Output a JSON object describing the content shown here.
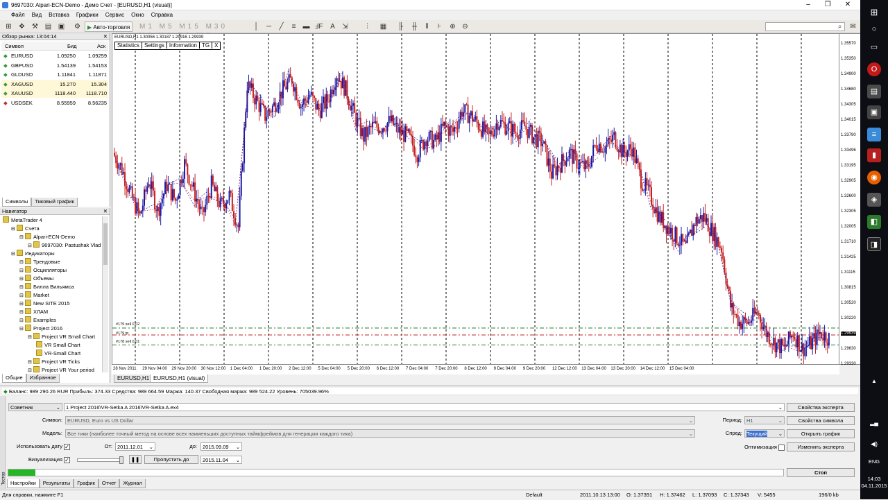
{
  "window": {
    "title": "9697030: Alpari-ECN-Demo - Демо Счет - [EURUSD,H1 (visual)]"
  },
  "menu": [
    "Файл",
    "Вид",
    "Вставка",
    "Графики",
    "Сервис",
    "Окно",
    "Справка"
  ],
  "toolbar": {
    "autotrade": "Авто-торговля",
    "timeframes": [
      "M1",
      "M5",
      "M15",
      "M30",
      "H1",
      "H4",
      "D1",
      "W1",
      "MN"
    ]
  },
  "market_watch": {
    "header": "Обзор рынка: 13:04:14",
    "columns": [
      "Символ",
      "Бид",
      "Аск"
    ],
    "rows": [
      {
        "symbol": "EURUSD",
        "bid": "1.09250",
        "ask": "1.09259",
        "color": "#3a9a3a"
      },
      {
        "symbol": "GBPUSD",
        "bid": "1.54139",
        "ask": "1.54153",
        "color": "#3a9a3a"
      },
      {
        "symbol": "GLDUSD",
        "bid": "1.11841",
        "ask": "1.11871",
        "color": "#3a9a3a"
      },
      {
        "symbol": "XAGUSD",
        "bid": "15.270",
        "ask": "15.304",
        "color": "#3a9a3a"
      },
      {
        "symbol": "XAUUSD",
        "bid": "1118.440",
        "ask": "1118.710",
        "color": "#3a9a3a"
      },
      {
        "symbol": "USDSEK",
        "bid": "8.55959",
        "ask": "8.56235",
        "color": "#c03030"
      }
    ],
    "tabs": [
      "Символы",
      "Тиковый график"
    ]
  },
  "navigator": {
    "header": "Навигатор",
    "items": [
      {
        "label": "MetaTrader 4",
        "level": 0
      },
      {
        "label": "Счета",
        "level": 1
      },
      {
        "label": "Alpari-ECN-Demo",
        "level": 2
      },
      {
        "label": "9697030: Pastushak Vlad",
        "level": 3
      },
      {
        "label": "Индикаторы",
        "level": 1
      },
      {
        "label": "Трендовые",
        "level": 2
      },
      {
        "label": "Осцилляторы",
        "level": 2
      },
      {
        "label": "Объемы",
        "level": 2
      },
      {
        "label": "Билла Вильямса",
        "level": 2
      },
      {
        "label": "Market",
        "level": 2
      },
      {
        "label": "New SITE 2015",
        "level": 2
      },
      {
        "label": "ХЛАМ",
        "level": 2
      },
      {
        "label": "Examples",
        "level": 2
      },
      {
        "label": "Project 2016",
        "level": 2
      },
      {
        "label": "Project VR Small Chart",
        "level": 3
      },
      {
        "label": "VR Small Chart",
        "level": 4
      },
      {
        "label": "VR-Small Chart",
        "level": 4
      },
      {
        "label": "Project VR Ticks",
        "level": 3
      },
      {
        "label": "Project VR Your period",
        "level": 3
      }
    ],
    "tabs": [
      "Общие",
      "Избранное"
    ]
  },
  "chart": {
    "info": "EURUSD,H1  1.30056 1.30187 1.29916 1.29939",
    "overlay_tabs": [
      "Statistics",
      "Settings",
      "Information",
      "TG",
      "X"
    ],
    "order_labels": [
      "#179 sell 0.02",
      "#179 tp",
      "#178 sell 0.01"
    ],
    "tabs": [
      "EURUSD,H1",
      "EURUSD,H1 (visual)"
    ],
    "current_price": "1.29939",
    "colors": {
      "bull": "#1a1aa8",
      "bear": "#c81e1e",
      "grid": "#000000"
    }
  },
  "chart_data": {
    "type": "candlestick",
    "symbol": "EURUSD",
    "timeframe": "H1",
    "x_ticks": [
      "28 Nov 2011",
      "29 Nov 04:00",
      "29 Nov 20:00",
      "30 Nov 12:00",
      "1 Dec 04:00",
      "1 Dec 20:00",
      "2 Dec 12:00",
      "5 Dec 04:00",
      "5 Dec 20:00",
      "6 Dec 12:00",
      "7 Dec 04:00",
      "7 Dec 20:00",
      "8 Dec 12:00",
      "9 Dec 04:00",
      "9 Dec 20:00",
      "12 Dec 12:00",
      "13 Dec 04:00",
      "13 Dec 20:00",
      "14 Dec 12:00",
      "15 Dec 04:00"
    ],
    "y_ticks": [
      "1.35570",
      "1.35350",
      "1.34900",
      "1.34680",
      "1.34305",
      "1.34015",
      "1.33790",
      "1.33496",
      "1.33195",
      "1.32905",
      "1.32600",
      "1.32305",
      "1.32005",
      "1.31710",
      "1.31425",
      "1.31115",
      "1.30815",
      "1.30520",
      "1.30220",
      "1.29939",
      "1.29630",
      "1.29330"
    ],
    "ylim": [
      1.2933,
      1.3557
    ],
    "close_path": [
      1.334,
      1.331,
      1.326,
      1.322,
      1.329,
      1.323,
      1.328,
      1.325,
      1.332,
      1.327,
      1.322,
      1.328,
      1.324,
      1.326,
      1.32,
      1.347,
      1.344,
      1.341,
      1.343,
      1.346,
      1.348,
      1.343,
      1.345,
      1.342,
      1.344,
      1.349,
      1.346,
      1.341,
      1.337,
      1.339,
      1.339,
      1.34,
      1.338,
      1.337,
      1.334,
      1.337,
      1.336,
      1.339,
      1.338,
      1.342,
      1.341,
      1.339,
      1.337,
      1.34,
      1.339,
      1.338,
      1.339,
      1.337,
      1.336,
      1.33,
      1.332,
      1.334,
      1.332,
      1.331,
      1.336,
      1.335,
      1.337,
      1.334,
      1.335,
      1.329,
      1.326,
      1.322,
      1.32,
      1.318,
      1.316,
      1.321,
      1.322,
      1.319,
      1.316,
      1.305,
      1.302,
      1.302,
      1.304,
      1.3,
      1.298,
      1.297,
      1.3,
      1.297,
      1.298,
      1.3,
      1.299
    ],
    "order_levels": [
      {
        "label": "#179 sell 0.02",
        "value": 1.3009
      },
      {
        "label": "#179 tp",
        "value": 1.2996
      },
      {
        "label": "#178 sell 0.01",
        "value": 1.2977
      }
    ]
  },
  "tester": {
    "type_value": "Советник",
    "expert_value": "1 Project 2016\\VR-Setka A 2016\\VR-Setka A.ex4",
    "symbol_label": "Символ:",
    "symbol_value": "EURUSD, Euro vs US Dollar",
    "model_label": "Модель:",
    "model_value": "Все тики (наиболее точный метод на основе всех наименьших доступных таймфреймов для генерации каждого тика)",
    "use_date_label": "Использовать дату",
    "from_label": "От:",
    "from_value": "2011.12.01",
    "to_label": "до:",
    "to_value": "2015.09.09",
    "visual_label": "Визуализация",
    "skip_label": "Пропустить до",
    "skip_value": "2015.11.04",
    "period_label": "Период:",
    "period_value": "H1",
    "spread_label": "Спред:",
    "spread_value": "Текущий",
    "optimization_label": "Оптимизация",
    "btn_expert_props": "Свойства эксперта",
    "btn_symbol_props": "Свойства символа",
    "btn_open_chart": "Открыть график",
    "btn_modify_expert": "Изменить эксперта",
    "btn_stop": "Стоп",
    "progress": 0.035,
    "balance_line": "Баланс: 989 290.26 RUR  Прибыль: 374.33  Средства: 989 664.59  Маржа: 140.37  Свободная маржа: 989 524.22  Уровень: 705039.96%",
    "tabs": [
      "Настройки",
      "Результаты",
      "График",
      "Отчет",
      "Журнал"
    ],
    "side_label": "Тестер"
  },
  "status": {
    "help": "Для справки, нажмите F1",
    "profile": "Default",
    "datetime": "2011.10.13 13:00",
    "open": "O: 1.37391",
    "high": "H: 1.37462",
    "low": "L: 1.37093",
    "close": "C: 1.37343",
    "volume": "V: 5455",
    "traffic": "196/0 kb"
  },
  "taskbar": {
    "lang": "ENG",
    "time": "14:03",
    "date": "04.11.2015"
  }
}
